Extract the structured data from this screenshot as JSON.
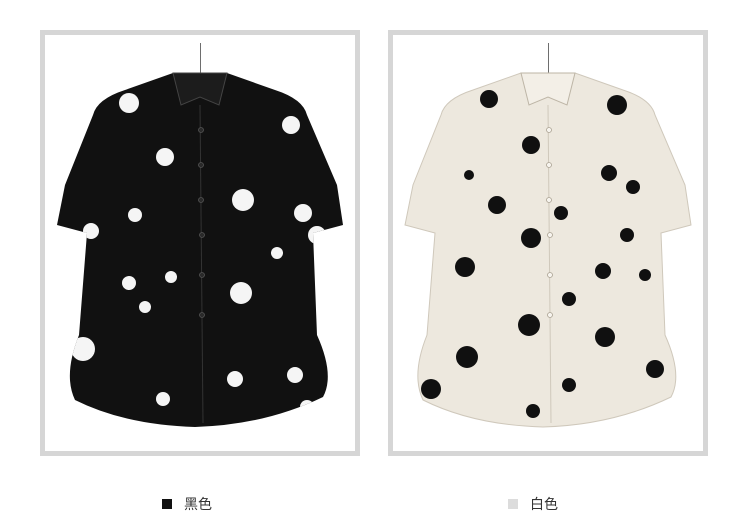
{
  "products": [
    {
      "label": "黑色",
      "swatch_color": "#111111",
      "garment_color": "#111111",
      "dot_color": "#f5f5f5"
    },
    {
      "label": "白色",
      "swatch_color": "#dcdcdc",
      "garment_color": "#ede8de",
      "dot_color": "#101010"
    }
  ]
}
